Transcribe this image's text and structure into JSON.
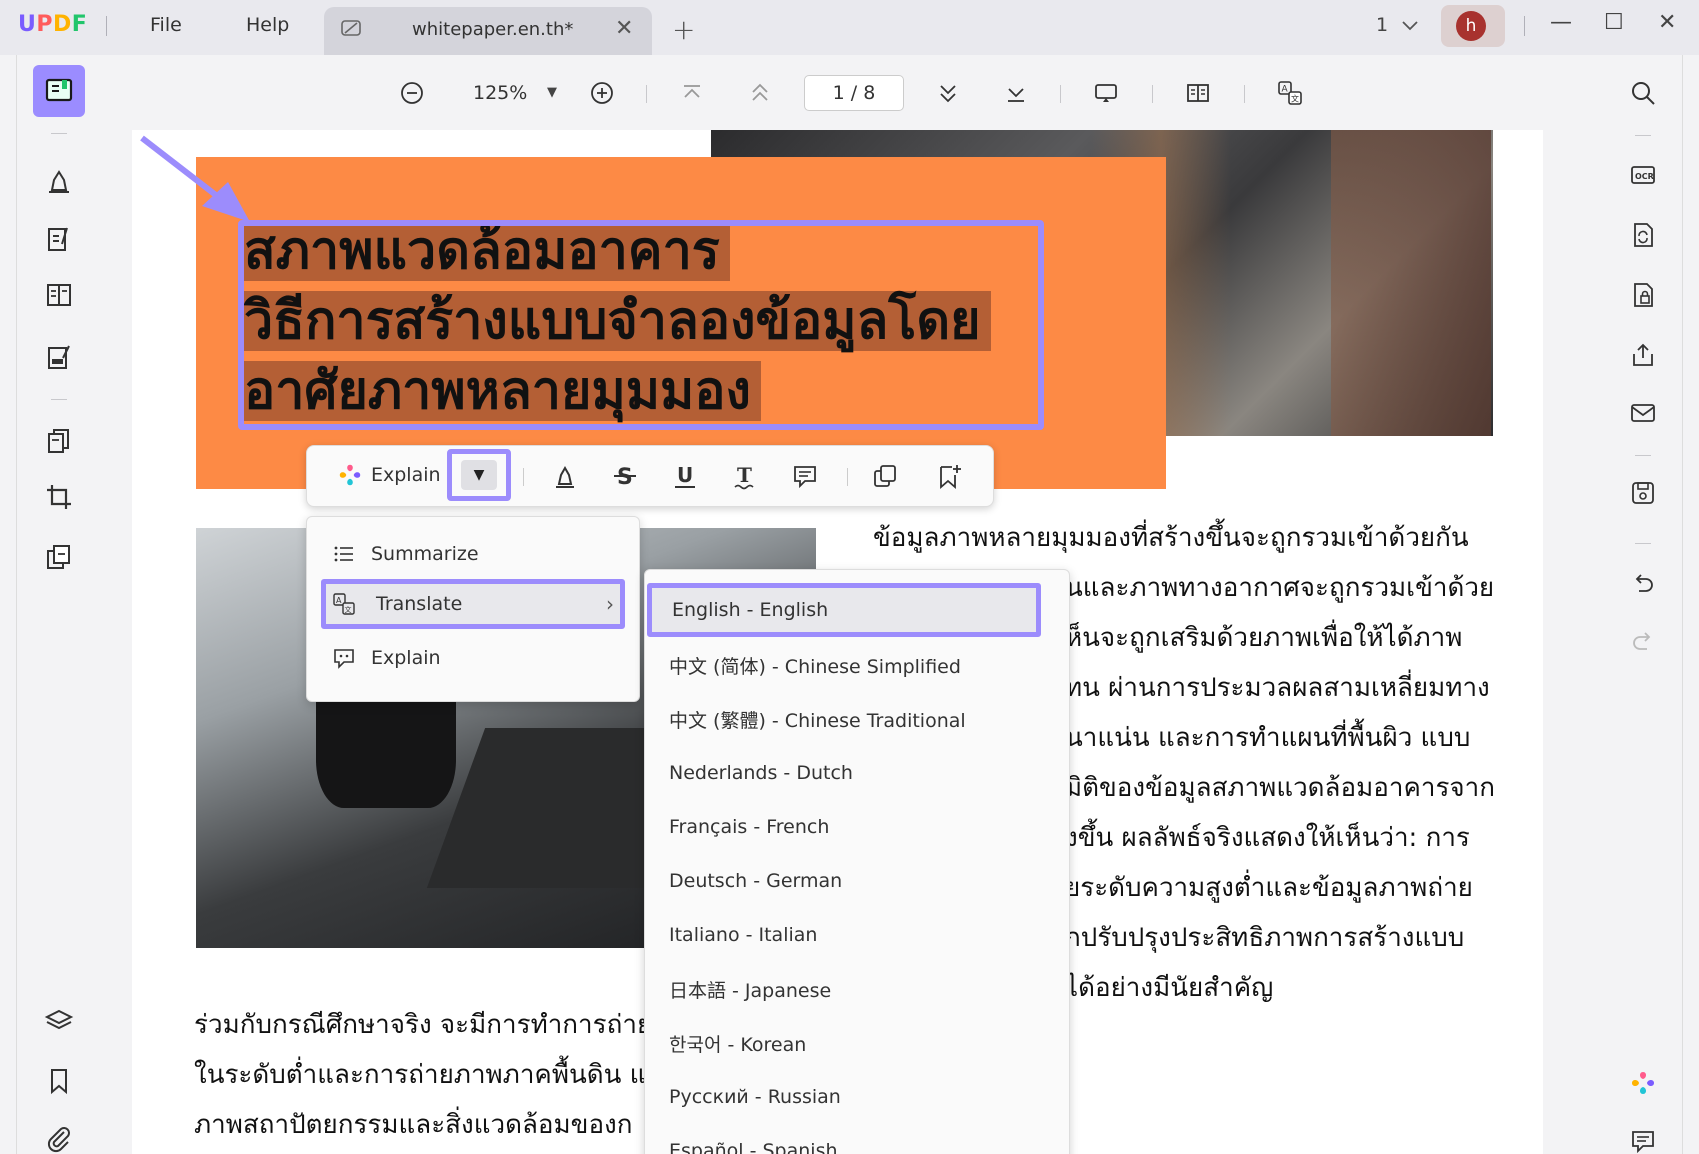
{
  "app": {
    "logo": "UPDF",
    "menu": [
      "File",
      "Help"
    ],
    "tab_title": "whitepaper.en.th*",
    "page_indicator": "1",
    "user_initial": "h"
  },
  "toolbar": {
    "zoom": "125%",
    "page_current": "1",
    "page_total": "8",
    "page_display": "1 / 8"
  },
  "document": {
    "title_lines": [
      "สภาพแวดล้อมอาคาร",
      "วิธีการสร้างแบบจำลองข้อมูลโดย",
      "อาศัยภาพหลายมุมมอง"
    ],
    "right_paragraph": [
      "ข้อมูลภาพหลายมุมมองที่สร้างขึ้นจะถูกรวมเข้าด้วยกัน",
      "นและภาพทางอากาศจะถูกรวมเข้าด้วย",
      "ห็นจะถูกเสริมด้วยภาพเพื่อให้ได้ภาพ",
      "ทน ผ่านการประมวลผลสามเหลี่ยมทาง",
      "นาแน่น และการทำแผนที่พื้นผิว แบบ",
      "มิติของข้อมูลสภาพแวดล้อมอาคารจาก",
      "งขึ้น ผลลัพธ์จริงแสดงให้เห็นว่า: การ",
      "ยระดับความสูงต่ำและข้อมูลภาพถ่าย",
      "กปรับปรุงประสิทธิภาพการสร้างแบบ",
      "ได้อย่างมีนัยสำคัญ"
    ],
    "bottom_paragraph": [
      "ร่วมกับกรณีศึกษาจริง จะมีการทำการถ่าย",
      "ในระดับต่ำและการถ่ายภาพภาคพื้นดิน แล",
      "ภาพสถาปัตยกรรมและสิ่งแวดล้อมของก"
    ]
  },
  "float_toolbar": {
    "explain_label": "Explain"
  },
  "ai_menu": {
    "items": [
      {
        "label": "Summarize",
        "icon": "list-icon"
      },
      {
        "label": "Translate",
        "icon": "translate-icon",
        "highlighted": true
      },
      {
        "label": "Explain",
        "icon": "explain-icon"
      }
    ]
  },
  "languages": [
    "English - English",
    "中文 (简体) - Chinese Simplified",
    "中文 (繁體) - Chinese Traditional",
    "Nederlands - Dutch",
    "Français - French",
    "Deutsch - German",
    "Italiano - Italian",
    "日本語 - Japanese",
    "한국어 - Korean",
    "Русский - Russian",
    "Español - Spanish"
  ],
  "colors": {
    "accent": "#9c8cfc",
    "orange_block": "#fd8a45",
    "avatar": "#a8322e"
  }
}
